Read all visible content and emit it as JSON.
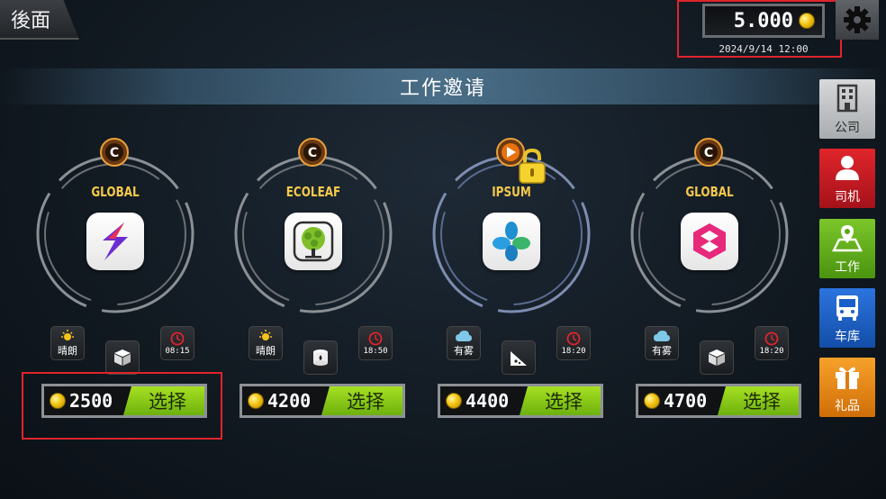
{
  "header": {
    "back_label": "後面",
    "wallet_amount": "5.000",
    "date": "2024/9/14 12:00"
  },
  "banner": {
    "title": "工作邀请"
  },
  "jobs": [
    {
      "brand": "GLOBAL",
      "weather": "晴朗",
      "time": "08:15",
      "price": "2500",
      "select_label": "选择",
      "locked": false
    },
    {
      "brand": "ECOLEAF",
      "weather": "晴朗",
      "time": "18:50",
      "price": "4200",
      "select_label": "选择",
      "locked": false
    },
    {
      "brand": "IPSUM",
      "weather": "有雾",
      "time": "18:20",
      "price": "4400",
      "select_label": "选择",
      "locked": true
    },
    {
      "brand": "GLOBAL",
      "weather": "有雾",
      "time": "18:20",
      "price": "4700",
      "select_label": "选择",
      "locked": false
    }
  ],
  "sidebar": {
    "items": [
      {
        "label": "公司",
        "icon": "building-icon",
        "color": "#b9bcbf"
      },
      {
        "label": "司机",
        "icon": "driver-icon",
        "color": "#c8191e"
      },
      {
        "label": "工作",
        "icon": "map-pin-icon",
        "color": "#5aa516"
      },
      {
        "label": "车库",
        "icon": "bus-icon",
        "color": "#1a5fc9"
      },
      {
        "label": "礼品",
        "icon": "gift-icon",
        "color": "#f08a12"
      }
    ]
  },
  "colors": {
    "accent_green": "#8dcb18",
    "brand_gold": "#f4c84a",
    "highlight_red": "#e0242b"
  }
}
